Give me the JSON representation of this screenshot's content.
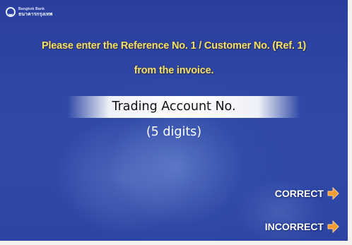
{
  "bank": {
    "name_en": "Bangkok Bank",
    "name_th": "ธนาคารกรุงเทพ"
  },
  "prompt": {
    "line1": "Please enter the Reference No. 1 / Customer No. (Ref. 1)",
    "line2": "from the invoice."
  },
  "field": {
    "label": "Trading Account No.",
    "hint": "(5 digits)"
  },
  "options": {
    "correct": "CORRECT",
    "incorrect": "INCORRECT"
  },
  "colors": {
    "prompt_text": "#f2df72",
    "background": "#2f47a6",
    "arrow": "#f29a2e"
  }
}
